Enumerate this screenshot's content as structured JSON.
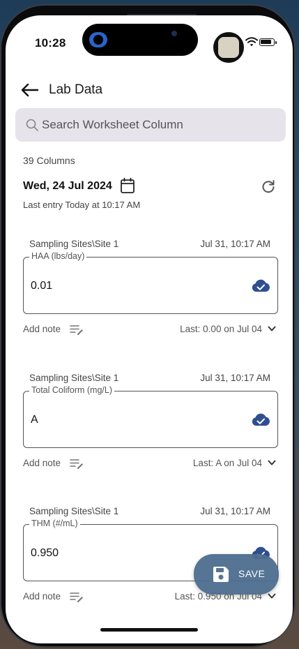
{
  "status_bar": {
    "time": "10:28"
  },
  "header": {
    "title": "Lab Data"
  },
  "search": {
    "placeholder": "Search Worksheet Column"
  },
  "summary": {
    "column_count": "39 Columns",
    "date": "Wed, 24 Jul 2024",
    "last_entry": "Last entry Today at 10:17 AM"
  },
  "entries": [
    {
      "site": "Sampling Sites\\Site 1",
      "timestamp": "Jul 31, 10:17 AM",
      "label": "HAA (lbs/day)",
      "value": "0.01",
      "add_note": "Add note",
      "last": "Last: 0.00 on Jul 04"
    },
    {
      "site": "Sampling Sites\\Site 1",
      "timestamp": "Jul 31, 10:17 AM",
      "label": "Total Coliform (mg/L)",
      "value": "A",
      "add_note": "Add note",
      "last": "Last: A on Jul 04"
    },
    {
      "site": "Sampling Sites\\Site 1",
      "timestamp": "Jul 31, 10:17 AM",
      "label": "THM (#/mL)",
      "value": "0.950",
      "add_note": "Add note",
      "last": "Last: 0.950 on Jul 04"
    }
  ],
  "save_button": {
    "label": "SAVE"
  },
  "colors": {
    "accent": "#2f4f8f",
    "fab": "#4e6d8f"
  }
}
